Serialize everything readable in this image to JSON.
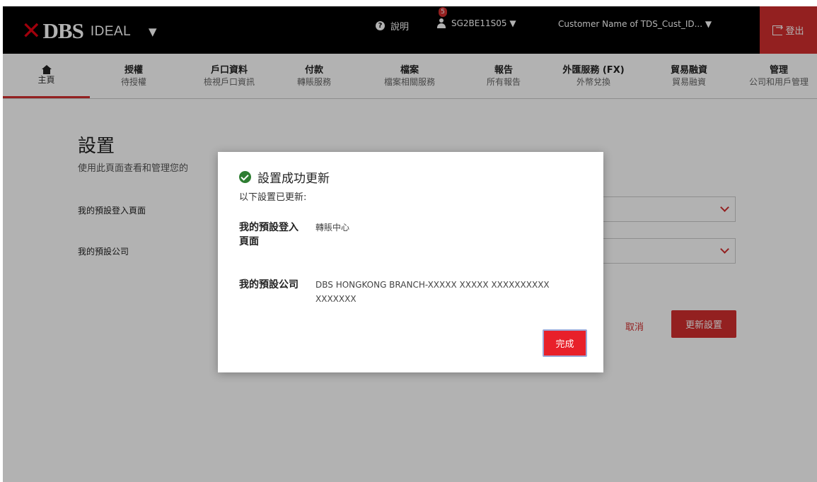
{
  "header": {
    "brand_x": "✕",
    "brand_dbs": "DBS",
    "brand_ideal": "IDEAL",
    "brand_caret": "▼",
    "help_label": "說明",
    "notification_count": "5",
    "user_id": "SG2BE11S05 ▼",
    "customer_name": "Customer Name of TDS_Cust_ID... ▼",
    "logout_label": "登出"
  },
  "nav": {
    "items": [
      {
        "title": "主頁",
        "sub": ""
      },
      {
        "title": "授權",
        "sub": "待授權"
      },
      {
        "title": "戶口資料",
        "sub": "檢視戶口資訊"
      },
      {
        "title": "付款",
        "sub": "轉賬服務"
      },
      {
        "title": "檔案",
        "sub": "檔案相關服務"
      },
      {
        "title": "報告",
        "sub": "所有報告"
      },
      {
        "title": "外匯服務 (FX)",
        "sub": "外幣兌換"
      },
      {
        "title": "貿易融資",
        "sub": "貿易融資"
      },
      {
        "title": "管理",
        "sub": "公司和用戶管理"
      }
    ]
  },
  "page": {
    "title": "設置",
    "description": "使用此頁面查看和管理您的",
    "field1_label": "我的預設登入頁面",
    "field2_label": "我的預設公司",
    "cancel_label": "取消",
    "update_label": "更新設置"
  },
  "modal": {
    "title": "設置成功更新",
    "subtitle": "以下設置已更新:",
    "row1_label": "我的預設登入頁面",
    "row1_value": "轉賬中心",
    "row2_label": "我的預設公司",
    "row2_value": "DBS HONGKONG BRANCH-XXXXX XXXXX XXXXXXXXXX XXXXXXX",
    "done_label": "完成"
  }
}
